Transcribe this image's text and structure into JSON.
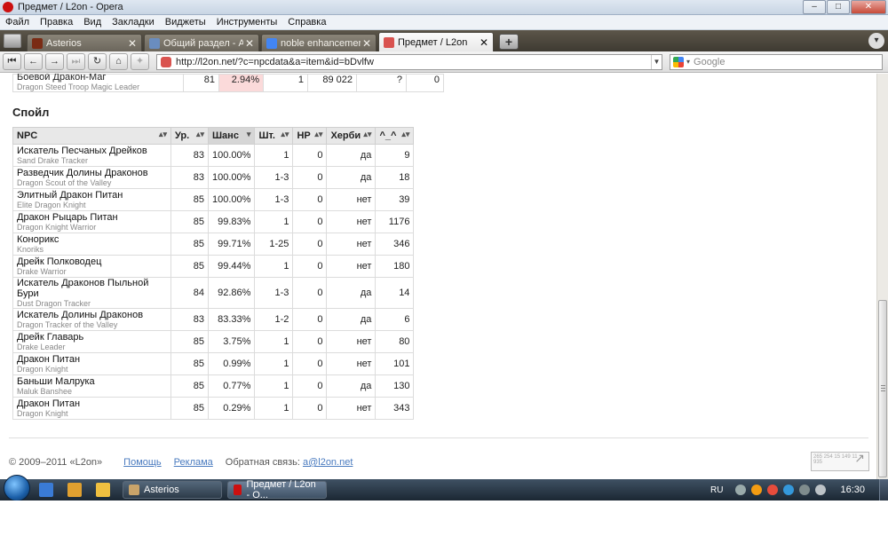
{
  "window": {
    "title": "Предмет / L2on - Opera"
  },
  "menu": [
    "Файл",
    "Правка",
    "Вид",
    "Закладки",
    "Виджеты",
    "Инструменты",
    "Справка"
  ],
  "tabs": [
    {
      "label": "Asterios",
      "active": false,
      "icon_color": "#7a2b14"
    },
    {
      "label": "Общий раздел - Asteri...",
      "active": false,
      "icon_color": "#6a8dbf"
    },
    {
      "label": "noble enhancement st...",
      "active": false,
      "icon_color": "#4285f4"
    },
    {
      "label": "Предмет / L2on",
      "active": true,
      "icon_color": "#d9534f"
    }
  ],
  "nav": {
    "url": "http://l2on.net/?c=npcdata&a=item&id=bDvlfw",
    "search_placeholder": "Google"
  },
  "prev_row": {
    "name_ru": "Боевой Дракон-Маг",
    "name_en": "Dragon Steed Troop Magic Leader",
    "level": "81",
    "chance": "2.94%",
    "count": "1",
    "hp": "89 022",
    "herbs": "?",
    "extra": "0"
  },
  "section": {
    "title": "Спойл"
  },
  "columns": [
    "NPC",
    "Ур.",
    "Шанс",
    "Шт.",
    "HP",
    "Херби",
    "^_^"
  ],
  "rows": [
    {
      "name_ru": "Искатель Песчаных Дрейков",
      "name_en": "Sand Drake Tracker",
      "level": "83",
      "chance": "100.00%",
      "count": "1",
      "hp": "0",
      "herbs": "да",
      "extra": "9"
    },
    {
      "name_ru": "Разведчик Долины Драконов",
      "name_en": "Dragon Scout of the Valley",
      "level": "83",
      "chance": "100.00%",
      "count": "1-3",
      "hp": "0",
      "herbs": "да",
      "extra": "18"
    },
    {
      "name_ru": "Элитный Дракон Питан",
      "name_en": "Elite Dragon Knight",
      "level": "85",
      "chance": "100.00%",
      "count": "1-3",
      "hp": "0",
      "herbs": "нет",
      "extra": "39"
    },
    {
      "name_ru": "Дракон Рыцарь Питан",
      "name_en": "Dragon Knight Warrior",
      "level": "85",
      "chance": "99.83%",
      "count": "1",
      "hp": "0",
      "herbs": "нет",
      "extra": "1176"
    },
    {
      "name_ru": "Конорикс",
      "name_en": "Knoriks",
      "level": "85",
      "chance": "99.71%",
      "count": "1-25",
      "hp": "0",
      "herbs": "нет",
      "extra": "346"
    },
    {
      "name_ru": "Дрейк Полководец",
      "name_en": "Drake Warrior",
      "level": "85",
      "chance": "99.44%",
      "count": "1",
      "hp": "0",
      "herbs": "нет",
      "extra": "180"
    },
    {
      "name_ru": "Искатель Драконов Пыльной Бури",
      "name_en": "Dust Dragon Tracker",
      "level": "84",
      "chance": "92.86%",
      "count": "1-3",
      "hp": "0",
      "herbs": "да",
      "extra": "14"
    },
    {
      "name_ru": "Искатель Долины Драконов",
      "name_en": "Dragon Tracker of the Valley",
      "level": "83",
      "chance": "83.33%",
      "count": "1-2",
      "hp": "0",
      "herbs": "да",
      "extra": "6"
    },
    {
      "name_ru": "Дрейк Главарь",
      "name_en": "Drake Leader",
      "level": "85",
      "chance": "3.75%",
      "count": "1",
      "hp": "0",
      "herbs": "нет",
      "extra": "80"
    },
    {
      "name_ru": "Дракон Питан",
      "name_en": "Dragon Knight",
      "level": "85",
      "chance": "0.99%",
      "count": "1",
      "hp": "0",
      "herbs": "нет",
      "extra": "101"
    },
    {
      "name_ru": "Баньши Малрука",
      "name_en": "Maluk Banshee",
      "level": "85",
      "chance": "0.77%",
      "count": "1",
      "hp": "0",
      "herbs": "да",
      "extra": "130"
    },
    {
      "name_ru": "Дракон Питан",
      "name_en": "Dragon Knight",
      "level": "85",
      "chance": "0.29%",
      "count": "1",
      "hp": "0",
      "herbs": "нет",
      "extra": "343"
    }
  ],
  "footer": {
    "copyright": "© 2009–2011 «L2on»",
    "help": "Помощь",
    "ads": "Реклама",
    "feedback_label": "Обратная связь:",
    "feedback_email": "a@l2on.net",
    "counter_text": "265 254 15 149 11 935"
  },
  "taskbar": {
    "tasks": [
      {
        "label": "Asterios",
        "active": false,
        "icon_color": "#c9a46a"
      },
      {
        "label": "Предмет / L2on - O...",
        "active": true,
        "icon_color": "#cc1010"
      }
    ],
    "lang": "RU",
    "time": "16:30",
    "quicklaunch_colors": [
      "#3a7bd5",
      "#e0a030",
      "#f0c040"
    ],
    "tray_colors": [
      "#9aa",
      "#f39c12",
      "#e74c3c",
      "#3498db",
      "#7f8c8d",
      "#bdc3c7"
    ]
  }
}
